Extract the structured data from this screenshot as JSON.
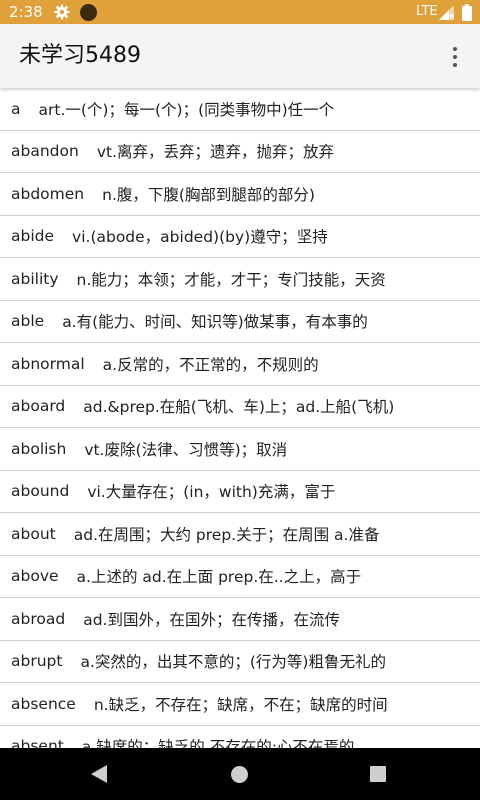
{
  "status_bar": {
    "time": "2:38",
    "network": "LTE",
    "icons": [
      "gear-icon",
      "notification-dot-icon",
      "signal-icon",
      "battery-icon"
    ],
    "background": "#e0a03a"
  },
  "app_bar": {
    "title": "未学习5489",
    "menu_icon": "overflow-menu-icon"
  },
  "words": [
    {
      "word": "a",
      "definition": "art.一(个)；每一(个)；(同类事物中)任一个"
    },
    {
      "word": "abandon",
      "definition": "vt.离弃，丢弃；遗弃，抛弃；放弃"
    },
    {
      "word": "abdomen",
      "definition": "n.腹，下腹(胸部到腿部的部分)"
    },
    {
      "word": "abide",
      "definition": "vi.(abode，abided)(by)遵守；坚持"
    },
    {
      "word": "ability",
      "definition": "n.能力；本领；才能，才干；专门技能，天资"
    },
    {
      "word": "able",
      "definition": "a.有(能力、时间、知识等)做某事，有本事的"
    },
    {
      "word": "abnormal",
      "definition": "a.反常的，不正常的，不规则的"
    },
    {
      "word": "aboard",
      "definition": "ad.&prep.在船(飞机、车)上；ad.上船(飞机)"
    },
    {
      "word": "abolish",
      "definition": "vt.废除(法律、习惯等)；取消"
    },
    {
      "word": "abound",
      "definition": "vi.大量存在；(in，with)充满，富于"
    },
    {
      "word": "about",
      "definition": "ad.在周围；大约 prep.关于；在周围 a.准备"
    },
    {
      "word": "above",
      "definition": "a.上述的 ad.在上面  prep.在..之上，高于"
    },
    {
      "word": "abroad",
      "definition": "ad.到国外，在国外；在传播，在流传"
    },
    {
      "word": "abrupt",
      "definition": "a.突然的，出其不意的；(行为等)粗鲁无礼的"
    },
    {
      "word": "absence",
      "definition": "n.缺乏，不存在；缺席，不在；缺席的时间"
    },
    {
      "word": "absent",
      "definition": "a.缺席的；缺乏的,不存在的;心不在焉的"
    }
  ],
  "nav_bar": {
    "icons": [
      "back-icon",
      "home-icon",
      "recents-icon"
    ]
  }
}
